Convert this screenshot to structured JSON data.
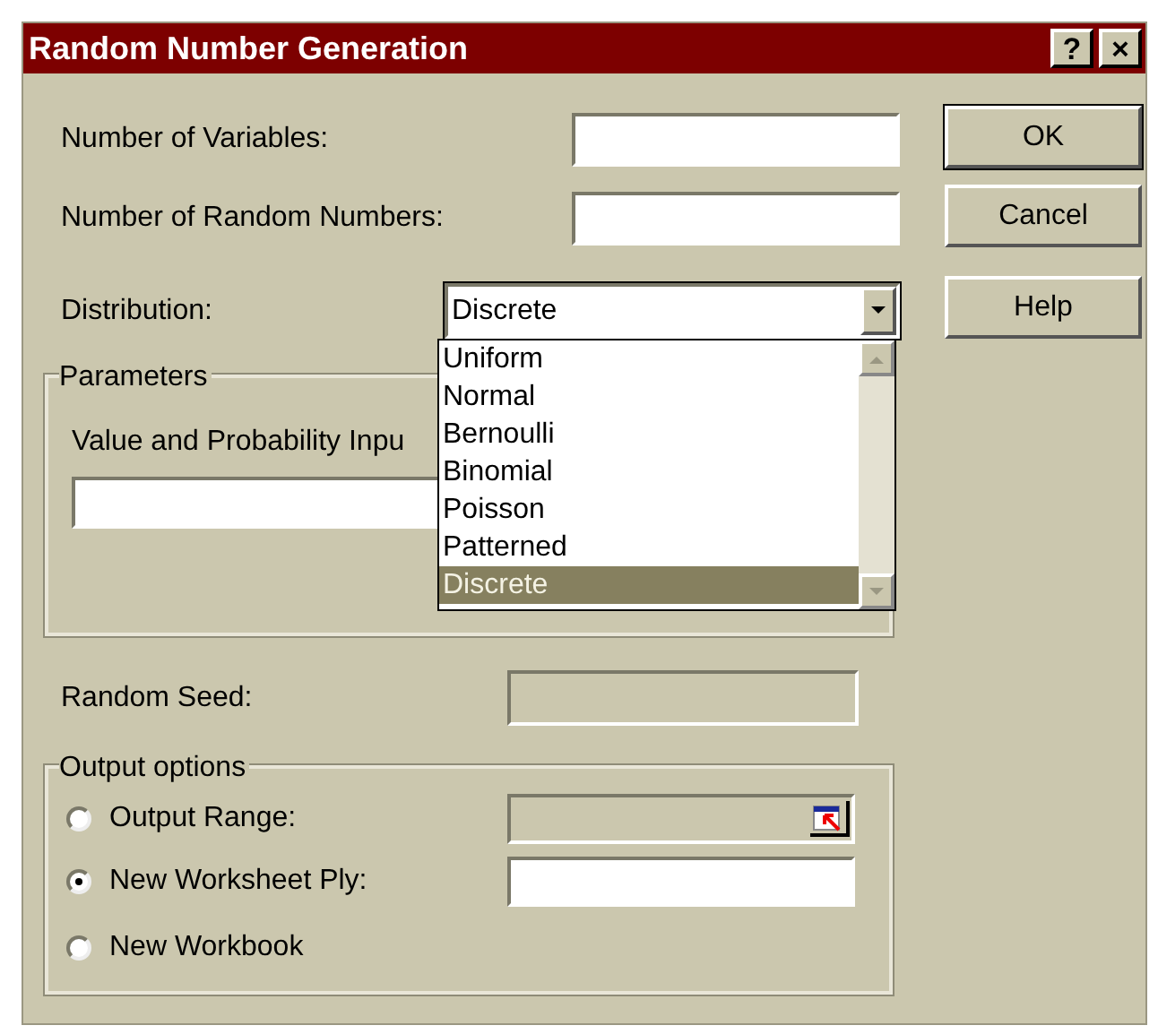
{
  "window": {
    "title": "Random Number Generation",
    "title_buttons": [
      "?",
      "×"
    ]
  },
  "fields": [
    {
      "label": "Number of Variables:"
    },
    {
      "label": "Number of Random Numbers:"
    }
  ],
  "distribution": {
    "label": "Distribution:",
    "value": "Discrete",
    "expanded": true,
    "options": [
      {
        "label": "Uniform",
        "selected": false
      },
      {
        "label": "Normal",
        "selected": false
      },
      {
        "label": "Bernoulli",
        "selected": false
      },
      {
        "label": "Binomial",
        "selected": false
      },
      {
        "label": "Poisson",
        "selected": false
      },
      {
        "label": "Patterned",
        "selected": false
      },
      {
        "label": "Discrete",
        "selected": true
      }
    ]
  },
  "buttons": [
    {
      "label": "OK",
      "default": true
    },
    {
      "label": "Cancel",
      "default": false
    },
    {
      "label": "Help",
      "default": false
    }
  ],
  "parameters": {
    "title": "Parameters",
    "input_label": "Value and Probability Inpu"
  },
  "random_seed": {
    "label": "Random Seed:",
    "disabled": true
  },
  "output_options": {
    "title": "Output options",
    "options": [
      {
        "label": "Output Range:",
        "selected": false,
        "kind": "range",
        "disabled": true
      },
      {
        "label": "New Worksheet Ply:",
        "selected": true,
        "kind": "text",
        "disabled": false
      },
      {
        "label": "New Workbook",
        "selected": false,
        "kind": "none"
      }
    ]
  }
}
